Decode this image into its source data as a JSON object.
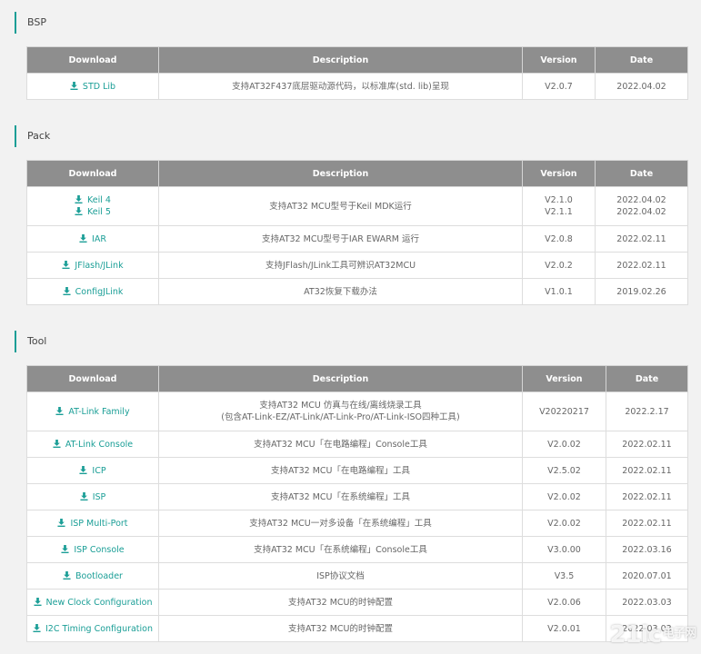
{
  "headers": {
    "download": "Download",
    "description": "Description",
    "version": "Version",
    "date": "Date"
  },
  "sections": {
    "bsp": {
      "title": "BSP",
      "rows": [
        {
          "links": [
            "STD Lib"
          ],
          "description": [
            "支持AT32F437底层驱动源代码，以标准库(std. lib)呈现"
          ],
          "version": [
            "V2.0.7"
          ],
          "date": [
            "2022.04.02"
          ]
        }
      ]
    },
    "pack": {
      "title": "Pack",
      "rows": [
        {
          "links": [
            "Keil 4",
            "Keil 5"
          ],
          "description": [
            "支持AT32 MCU型号于Keil MDK运行"
          ],
          "version": [
            "V2.1.0",
            "V2.1.1"
          ],
          "date": [
            "2022.04.02",
            "2022.04.02"
          ]
        },
        {
          "links": [
            "IAR"
          ],
          "description": [
            "支持AT32 MCU型号于IAR EWARM 运行"
          ],
          "version": [
            "V2.0.8"
          ],
          "date": [
            "2022.02.11"
          ]
        },
        {
          "links": [
            "JFlash/JLink"
          ],
          "description": [
            "支持JFlash/JLink工具可辨识AT32MCU"
          ],
          "version": [
            "V2.0.2"
          ],
          "date": [
            "2022.02.11"
          ]
        },
        {
          "links": [
            "ConfigJLink"
          ],
          "description": [
            "AT32恢复下载办法"
          ],
          "version": [
            "V1.0.1"
          ],
          "date": [
            "2019.02.26"
          ]
        }
      ]
    },
    "tool": {
      "title": "Tool",
      "rows": [
        {
          "links": [
            "AT-Link Family"
          ],
          "description": [
            "支持AT32 MCU 仿真与在线/离线烧录工具",
            "(包含AT-Link-EZ/AT-Link/AT-Link-Pro/AT-Link-ISO四种工具)"
          ],
          "version": [
            "V20220217"
          ],
          "date": [
            "2022.2.17"
          ]
        },
        {
          "links": [
            "AT-Link Console"
          ],
          "description": [
            "支持AT32 MCU「在电路编程」Console工具"
          ],
          "version": [
            "V2.0.02"
          ],
          "date": [
            "2022.02.11"
          ]
        },
        {
          "links": [
            "ICP"
          ],
          "description": [
            "支持AT32 MCU「在电路编程」工具"
          ],
          "version": [
            "V2.5.02"
          ],
          "date": [
            "2022.02.11"
          ]
        },
        {
          "links": [
            "ISP"
          ],
          "description": [
            "支持AT32 MCU「在系统编程」工具"
          ],
          "version": [
            "V2.0.02"
          ],
          "date": [
            "2022.02.11"
          ]
        },
        {
          "links": [
            "ISP Multi-Port"
          ],
          "description": [
            "支持AT32 MCU一对多设备「在系统编程」工具"
          ],
          "version": [
            "V2.0.02"
          ],
          "date": [
            "2022.02.11"
          ]
        },
        {
          "links": [
            "ISP Console"
          ],
          "description": [
            "支持AT32 MCU「在系统编程」Console工具"
          ],
          "version": [
            "V3.0.00"
          ],
          "date": [
            "2022.03.16"
          ]
        },
        {
          "links": [
            "Bootloader"
          ],
          "description": [
            "ISP协议文档"
          ],
          "version": [
            "V3.5"
          ],
          "date": [
            "2020.07.01"
          ]
        },
        {
          "links": [
            "New Clock Configuration"
          ],
          "description": [
            "支持AT32 MCU的时钟配置"
          ],
          "version": [
            "V2.0.06"
          ],
          "date": [
            "2022.03.03"
          ]
        },
        {
          "links": [
            "I2C Timing Configuration"
          ],
          "description": [
            "支持AT32 MCU的时钟配置"
          ],
          "version": [
            "V2.0.01"
          ],
          "date": [
            "2022.03.03"
          ]
        }
      ]
    }
  },
  "watermark": {
    "logo": "21ic",
    "text": "电子网"
  },
  "icon": "download-icon",
  "colors": {
    "accent": "#1a9e96",
    "header_bg": "#8e8e8e",
    "page_bg": "#f2f2f2"
  }
}
